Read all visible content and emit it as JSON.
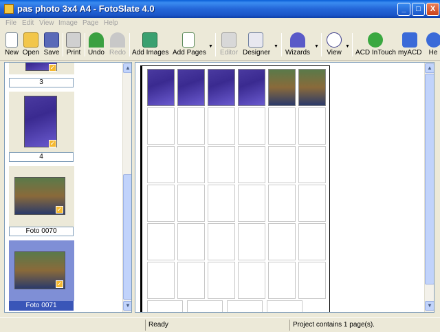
{
  "window": {
    "title": "pas photo 3x4 A4 - FotoSlate 4.0",
    "minimize": "_",
    "maximize": "□",
    "close": "X"
  },
  "menu": [
    "File",
    "Edit",
    "View",
    "Image",
    "Page",
    "Help"
  ],
  "toolbar": {
    "new": "New",
    "open": "Open",
    "save": "Save",
    "print": "Print",
    "undo": "Undo",
    "redo": "Redo",
    "add_images": "Add Images",
    "add_pages": "Add Pages",
    "editor": "Editor",
    "designer": "Designer",
    "wizards": "Wizards",
    "view": "View",
    "acd_intouch": "ACD InTouch",
    "myacd": "myACD",
    "help": "He"
  },
  "thumbnails": [
    {
      "label": "3",
      "kind": "wedding"
    },
    {
      "label": "4",
      "kind": "wedding"
    },
    {
      "label": "Foto 0070",
      "kind": "kids"
    },
    {
      "label": "Foto 0071",
      "kind": "kids",
      "selected": true
    }
  ],
  "page": {
    "filled_photos": [
      "wedding",
      "wedding",
      "wedding",
      "wedding",
      "kids",
      "kids"
    ]
  },
  "status": {
    "state": "Ready",
    "info": "Project contains 1 page(s)."
  },
  "colors": {
    "title_bar": "#2466d8",
    "selection": "#7f8fd6",
    "selected_label": "#3a56b8"
  }
}
